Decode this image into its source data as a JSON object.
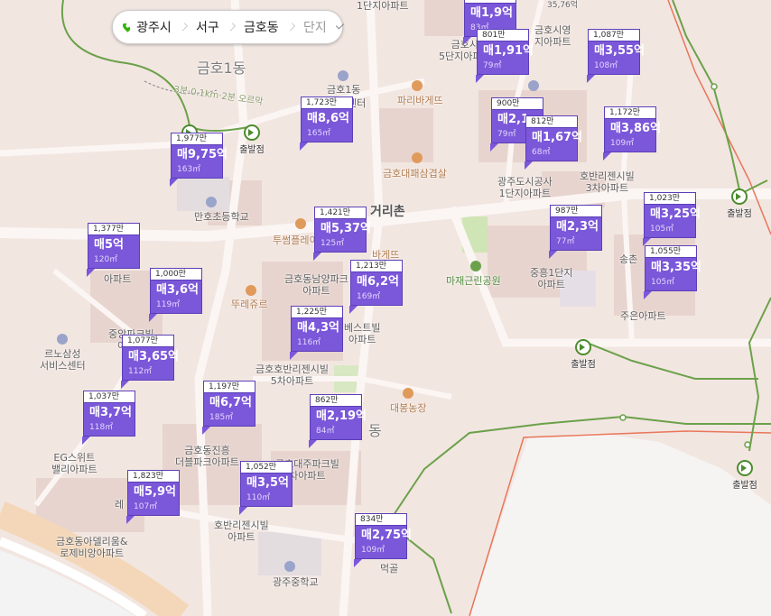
{
  "breadcrumb": {
    "region": "광주시",
    "district": "서구",
    "dong": "금호동",
    "filter": "단지"
  },
  "colors": {
    "marker_purple": "#7b57d9",
    "trail_green": "#5a9a3c",
    "boundary_red": "#e8765a",
    "pin_green": "#2db400"
  },
  "map_labels": {
    "area_big": "금호1동",
    "crossroad": "거리촌",
    "dong_fragment": "동",
    "trail_text": "3분·0.1km·2분 오르막",
    "apt_1danji_top": "1단지아파트",
    "apt_5danji": "금호시\n5단지아파트",
    "apt_siyeong": "금호시영\n지아파트",
    "office_1dong": "금호1동",
    "center": "센터",
    "paris1": "파리바게뜨",
    "paris2": "바게뜨",
    "market": "금호대패삼겹살",
    "school1": "만호초등학교",
    "twosome": "투썸플레이",
    "tous": "뚜레쥬르",
    "lotte": "르노삼성\n서비스센터",
    "jungheung": "중흥1단지\n아파트",
    "mazae": "마재근린공원",
    "songchon": "송촌",
    "jueun": "주은아파트",
    "bestville": "베스트빌\n아파트",
    "hobani5": "금호호반리젠시빌\n5차아파트",
    "hobani3": "호반리젠시빌\n3차아파트",
    "gwangjudosi": "광주도시공사\n1단지아파트",
    "daebong": "대봉농장",
    "jinheung": "금호동진흥\n더블파크아파트",
    "daeju": "금호대주파크빌\n차아파트",
    "egsuite": "EG스위트\n밸리아파트",
    "hobani_bottom": "호반리젠시빌\n아파트",
    "hanyang_apt": "아파트",
    "nampyeong": "금호동남양파크\n아파트",
    "jung_apt": "중앙파크빌\n아파트",
    "re": "레",
    "mado": "금호동아델리움&\n로제비앙아파트",
    "school2": "광주중학교",
    "start_label": "출발점",
    "meok": "먹골",
    "ville_top": "35,76억"
  },
  "markers": [
    {
      "ppp": "",
      "price": "매1,9억",
      "area": "83㎡"
    },
    {
      "ppp": "801만",
      "price": "매1,91억",
      "area": "79㎡"
    },
    {
      "ppp": "1,087만",
      "price": "매3,55억",
      "area": "108㎡"
    },
    {
      "ppp": "1,723만",
      "price": "매8,6억",
      "area": "165㎡"
    },
    {
      "ppp": "900만",
      "price": "매2,1",
      "area": "79㎡"
    },
    {
      "ppp": "812만",
      "price": "매1,67억",
      "area": "68㎡"
    },
    {
      "ppp": "1,172만",
      "price": "매3,86억",
      "area": "109㎡"
    },
    {
      "ppp": "1,977만",
      "price": "매9,75억",
      "area": "163㎡"
    },
    {
      "ppp": "1,023만",
      "price": "매3,25억",
      "area": "105㎡"
    },
    {
      "ppp": "1,421만",
      "price": "매5,37억",
      "area": "125㎡"
    },
    {
      "ppp": "987만",
      "price": "매2,3억",
      "area": "77㎡"
    },
    {
      "ppp": "1,377만",
      "price": "매5억",
      "area": "120㎡"
    },
    {
      "ppp": "1,055만",
      "price": "매3,35억",
      "area": "105㎡"
    },
    {
      "ppp": "1,213만",
      "price": "매6,2억",
      "area": "169㎡"
    },
    {
      "ppp": "1,000만",
      "price": "매3,6억",
      "area": "119㎡"
    },
    {
      "ppp": "1,225만",
      "price": "매4,3억",
      "area": "116㎡"
    },
    {
      "ppp": "1,077만",
      "price": "매3,65억",
      "area": "112㎡"
    },
    {
      "ppp": "1,197만",
      "price": "매6,7억",
      "area": "185㎡"
    },
    {
      "ppp": "1,037만",
      "price": "매3,7억",
      "area": "118㎡"
    },
    {
      "ppp": "862만",
      "price": "매2,19억",
      "area": "84㎡"
    },
    {
      "ppp": "1,052만",
      "price": "매3,5억",
      "area": "110㎡"
    },
    {
      "ppp": "1,823만",
      "price": "매5,9억",
      "area": "107㎡"
    },
    {
      "ppp": "834만",
      "price": "매2,75억",
      "area": "109㎡"
    }
  ]
}
